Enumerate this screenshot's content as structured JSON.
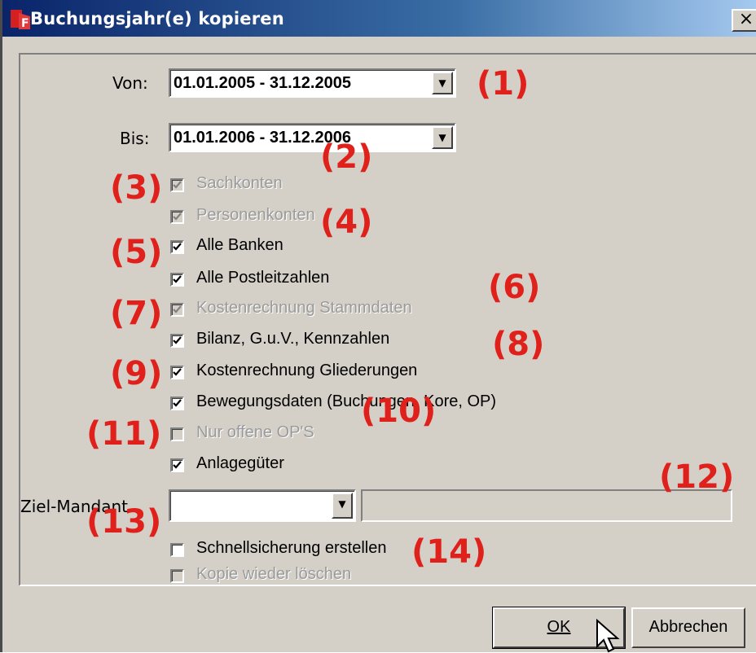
{
  "window": {
    "title": "Buchungsjahr(e) kopieren",
    "close_label": "×",
    "icon": "app-icon"
  },
  "von": {
    "label": "Von:",
    "value": "01.01.2005 - 31.12.2005"
  },
  "bis": {
    "label": "Bis:",
    "value": "01.01.2006 - 31.12.2006"
  },
  "options": [
    {
      "label": "Sachkonten",
      "checked": true,
      "enabled": false
    },
    {
      "label": "Personenkonten",
      "checked": true,
      "enabled": false
    },
    {
      "label": "Alle Banken",
      "checked": true,
      "enabled": true
    },
    {
      "label": "Alle Postleitzahlen",
      "checked": true,
      "enabled": true
    },
    {
      "label": "Kostenrechnung Stammdaten",
      "checked": true,
      "enabled": false
    },
    {
      "label": "Bilanz, G.u.V., Kennzahlen",
      "checked": true,
      "enabled": true
    },
    {
      "label": "Kostenrechnung Gliederungen",
      "checked": true,
      "enabled": true
    },
    {
      "label": "Bewegungsdaten (Buchungen, Kore, OP)",
      "checked": true,
      "enabled": true
    },
    {
      "label": "Nur offene OP'S",
      "checked": false,
      "enabled": false
    },
    {
      "label": "Anlagegüter",
      "checked": true,
      "enabled": true
    }
  ],
  "ziel_mandant": {
    "label": "Ziel-Mandant",
    "value": "",
    "description": ""
  },
  "extra_options": [
    {
      "label": "Schnellsicherung erstellen",
      "checked": false,
      "enabled": true
    },
    {
      "label": "Kopie wieder löschen",
      "checked": false,
      "enabled": false
    }
  ],
  "buttons": {
    "ok": "OK",
    "cancel": "Abbrechen"
  },
  "markers": [
    "(1)",
    "(2)",
    "(3)",
    "(4)",
    "(5)",
    "(6)",
    "(7)",
    "(8)",
    "(9)",
    "(10)",
    "(11)",
    "(12)",
    "(13)",
    "(14)"
  ],
  "colors": {
    "marker": "#e0201a",
    "title_start": "#0a246a",
    "title_end": "#a6caf0",
    "dialog_bg": "#d4d0c8"
  }
}
